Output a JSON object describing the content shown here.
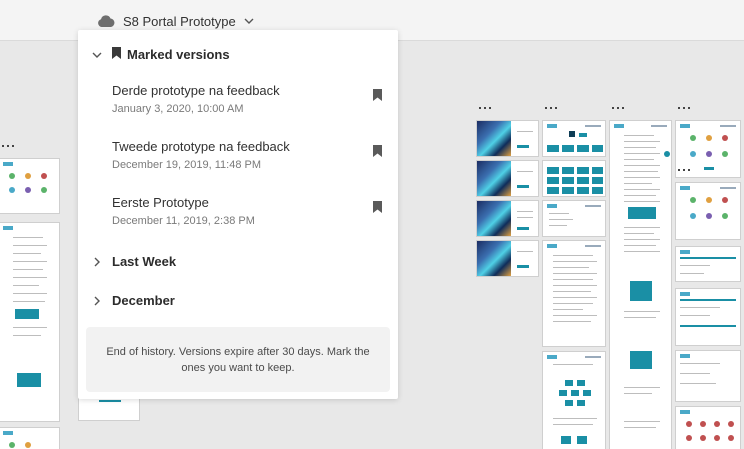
{
  "header": {
    "document_title": "S8 Portal Prototype",
    "cloud_icon": "cloud-icon",
    "dropdown_icon": "chevron-down-icon"
  },
  "panel": {
    "marked_versions": {
      "label": "Marked versions",
      "expanded": true,
      "items": [
        {
          "name": "Derde prototype na feedback",
          "date": "January 3, 2020, 10:00 AM",
          "bookmarked": true
        },
        {
          "name": "Tweede prototype na feedback",
          "date": "December 19, 2019, 11:48 PM",
          "bookmarked": true
        },
        {
          "name": "Eerste Prototype",
          "date": "December 11, 2019, 2:38 PM",
          "bookmarked": true
        }
      ]
    },
    "sections": [
      {
        "label": "Last Week",
        "expanded": false
      },
      {
        "label": "December",
        "expanded": false
      }
    ],
    "footer_note": "End of history. Versions expire after 30 days. Mark the ones you want to keep."
  },
  "colors": {
    "accent": "#1a8fa5",
    "canvas_bg": "#e8e8e8",
    "panel_bg": "#ffffff",
    "note_bg": "#f2f2f2"
  }
}
